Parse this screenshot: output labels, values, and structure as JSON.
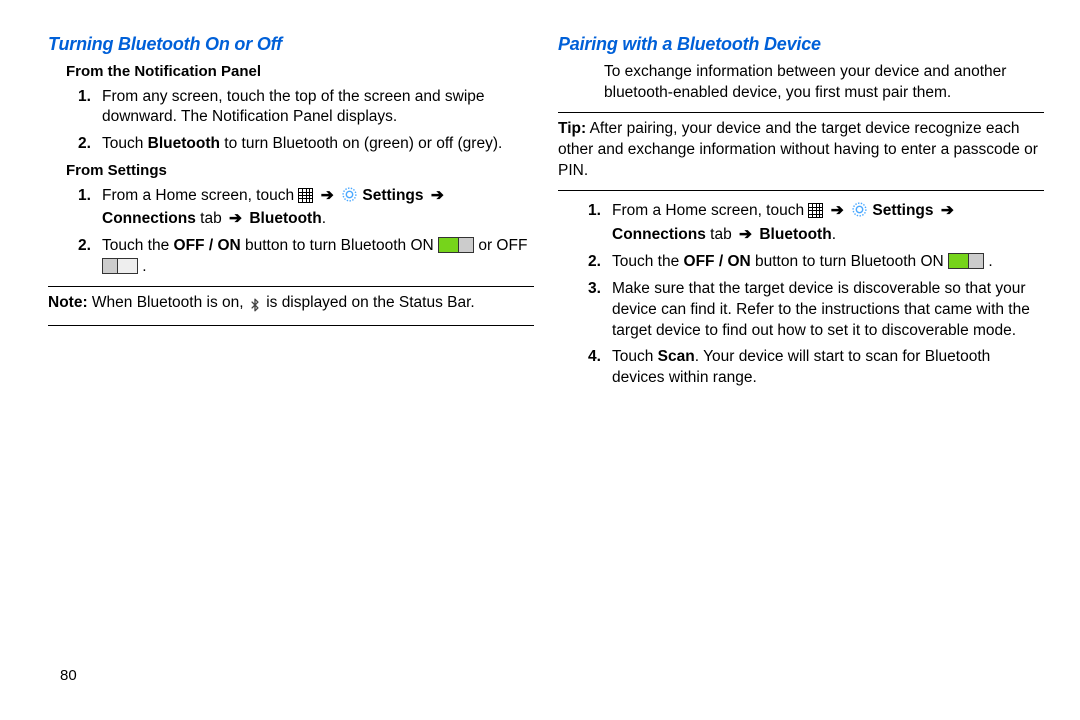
{
  "pageNumber": "80",
  "left": {
    "heading": "Turning Bluetooth On or Off",
    "sub1": "From the Notification Panel",
    "steps1": [
      {
        "n": "1.",
        "text": "From any screen, touch the top of the screen and swipe downward. The Notification Panel displays."
      },
      {
        "n": "2.",
        "pre": "Touch ",
        "bold1": "Bluetooth",
        "mid": " to turn Bluetooth on (green) or off (grey)."
      }
    ],
    "sub2": "From Settings",
    "steps2_item1": {
      "n": "1.",
      "pre": "From a Home screen, touch ",
      "settings": "Settings",
      "connections": "Connections",
      "tabWord": " tab ",
      "bluetooth": "Bluetooth"
    },
    "steps2_item2": {
      "n": "2.",
      "pre": "Touch the ",
      "offon": "OFF / ON",
      "mid": " button to turn Bluetooth ON ",
      "orOff": " or OFF "
    },
    "noteLabel": "Note:",
    "noteText": " When Bluetooth is on, ",
    "noteTail": " is displayed on the Status Bar."
  },
  "right": {
    "heading": "Pairing with a Bluetooth Device",
    "intro": "To exchange information between your device and another bluetooth-enabled device, you first must pair them.",
    "tipLabel": "Tip:",
    "tipText": " After pairing, your device and the target device recognize each other and exchange information without having to enter a passcode or PIN.",
    "steps": {
      "s1": {
        "n": "1.",
        "pre": "From a Home screen, touch ",
        "settings": "Settings",
        "connections": "Connections",
        "tabWord": " tab ",
        "bluetooth": "Bluetooth"
      },
      "s2": {
        "n": "2.",
        "pre": "Touch the ",
        "offon": "OFF / ON",
        "mid": " button to turn Bluetooth ON "
      },
      "s3": {
        "n": "3.",
        "text": "Make sure that the target device is discoverable so that your device can find it. Refer to the instructions that came with the target device to find out how to set it to discoverable mode."
      },
      "s4": {
        "n": "4.",
        "pre": "Touch ",
        "scan": "Scan",
        "tail": ". Your device will start to scan for Bluetooth devices within range."
      }
    }
  }
}
